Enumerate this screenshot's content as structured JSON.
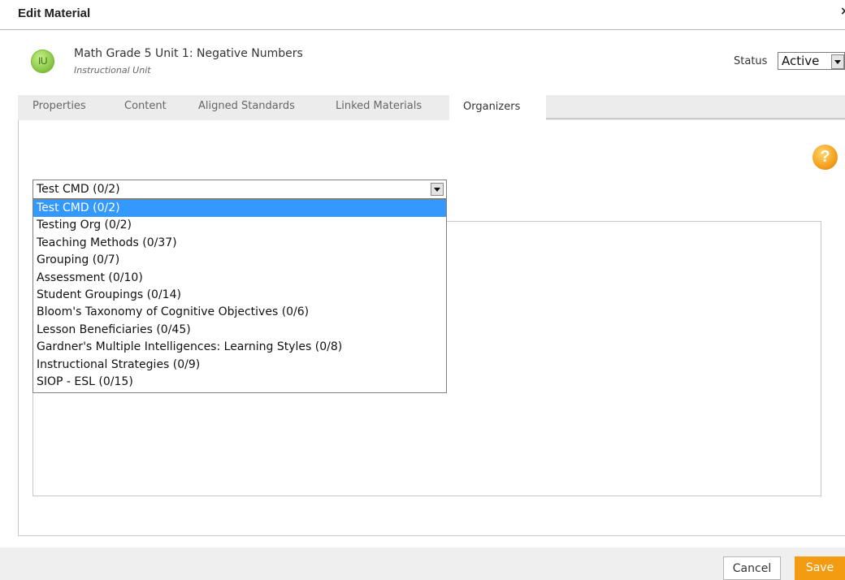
{
  "dialog": {
    "title": "Edit Material",
    "close_glyph": "×"
  },
  "material": {
    "badge": "IU",
    "title": "Math Grade 5 Unit 1: Negative Numbers",
    "type": "Instructional Unit"
  },
  "status": {
    "label": "Status",
    "value": "Active"
  },
  "tabs": [
    {
      "label": "Properties"
    },
    {
      "label": "Content"
    },
    {
      "label": "Aligned Standards"
    },
    {
      "label": "Linked Materials"
    },
    {
      "label": "Organizers",
      "active": true
    }
  ],
  "organizer_select": {
    "value": "Test CMD (0/2)",
    "options": [
      "Test CMD (0/2)",
      "Testing Org (0/2)",
      "Teaching Methods (0/37)",
      "Grouping (0/7)",
      "Assessment (0/10)",
      "Student Groupings (0/14)",
      "Bloom's Taxonomy of Cognitive Objectives (0/6)",
      "Lesson Beneficiaries (0/45)",
      "Gardner's Multiple Intelligences: Learning Styles (0/8)",
      "Instructional Strategies (0/9)",
      "SIOP - ESL (0/15)"
    ],
    "selected_index": 0
  },
  "help": {
    "glyph": "?"
  },
  "footer": {
    "cancel_label": "Cancel",
    "save_label": "Save"
  },
  "colors": {
    "accent": "#f39c12",
    "selection": "#3399ff",
    "badge": "#8fcc4a"
  }
}
